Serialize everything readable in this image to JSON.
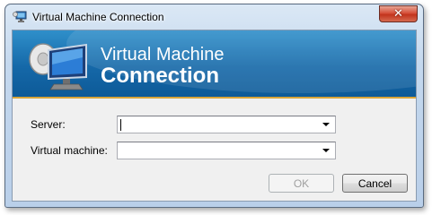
{
  "window": {
    "title": "Virtual Machine Connection"
  },
  "titlebar": {
    "close_label": "✕"
  },
  "banner": {
    "line1": "Virtual Machine",
    "line2": "Connection"
  },
  "form": {
    "server_label": "Server:",
    "server_value": "",
    "vm_label": "Virtual machine:",
    "vm_value": ""
  },
  "buttons": {
    "ok_label": "OK",
    "ok_enabled": false,
    "cancel_label": "Cancel"
  },
  "colors": {
    "banner": "#1568a8",
    "accent_edge": "#d9a53a",
    "close": "#c2341d"
  },
  "icons": [
    "vm-app-icon",
    "close-icon",
    "vm-monitor-icon",
    "dropdown-arrow-icon"
  ]
}
